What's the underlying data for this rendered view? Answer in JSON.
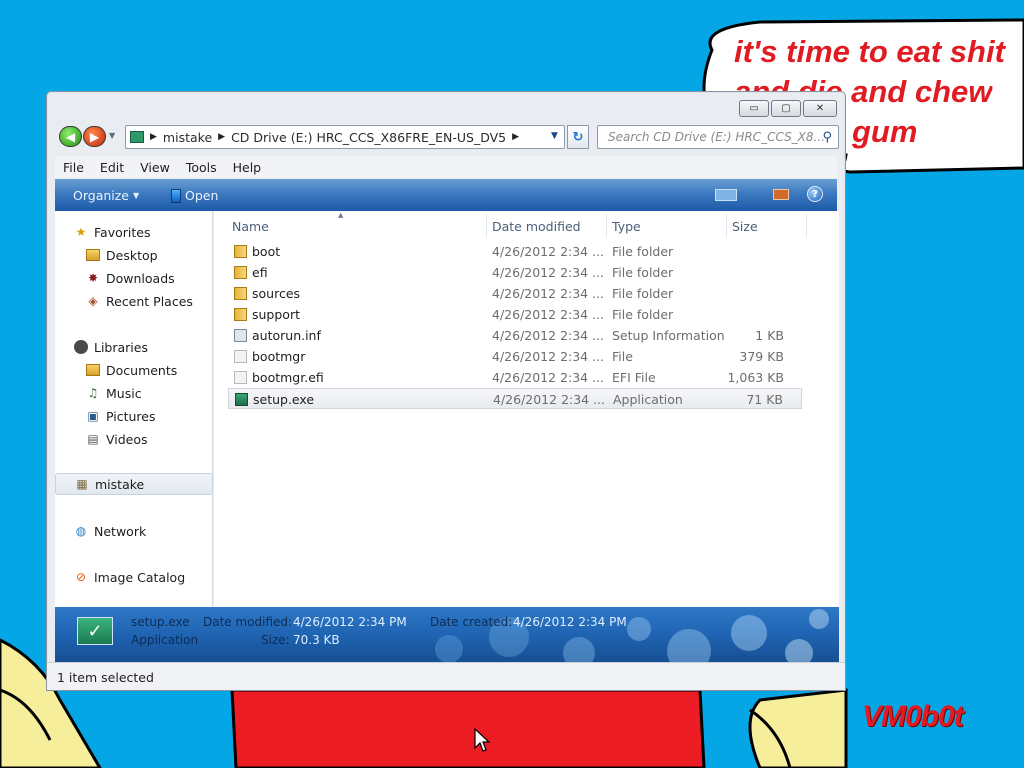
{
  "desktop": {
    "speech_bubble_lines": [
      "it's time to eat shit",
      "and die and chew",
      "gum"
    ],
    "watermark": "VM0b0t",
    "background_color": "#04a6e6"
  },
  "window": {
    "caption_buttons": {
      "minimize": "▭",
      "maximize": "▢",
      "close": "✕"
    },
    "address": {
      "segments": [
        "mistake",
        "CD Drive (E:) HRC_CCS_X86FRE_EN-US_DV5"
      ]
    },
    "search": {
      "placeholder": "Search CD Drive (E:) HRC_CCS_X8..."
    },
    "menu": [
      "File",
      "Edit",
      "View",
      "Tools",
      "Help"
    ],
    "toolbar": {
      "organize": "Organize",
      "open": "Open",
      "help": "?"
    },
    "nav": {
      "favorites": "Favorites",
      "favorites_items": [
        "Desktop",
        "Downloads",
        "Recent Places"
      ],
      "libraries": "Libraries",
      "libraries_items": [
        "Documents",
        "Music",
        "Pictures",
        "Videos"
      ],
      "user": "mistake",
      "network": "Network",
      "image_catalog": "Image Catalog"
    },
    "columns": {
      "name": "Name",
      "date": "Date modified",
      "type": "Type",
      "size": "Size"
    },
    "files": [
      {
        "name": "boot",
        "date": "4/26/2012 2:34 ...",
        "type": "File folder",
        "size": "",
        "icon": "folder-icon"
      },
      {
        "name": "efi",
        "date": "4/26/2012 2:34 ...",
        "type": "File folder",
        "size": "",
        "icon": "folder-icon"
      },
      {
        "name": "sources",
        "date": "4/26/2012 2:34 ...",
        "type": "File folder",
        "size": "",
        "icon": "folder-icon"
      },
      {
        "name": "support",
        "date": "4/26/2012 2:34 ...",
        "type": "File folder",
        "size": "",
        "icon": "folder-icon"
      },
      {
        "name": "autorun.inf",
        "date": "4/26/2012 2:34 ...",
        "type": "Setup Information",
        "size": "1 KB",
        "icon": "settings-file-icon"
      },
      {
        "name": "bootmgr",
        "date": "4/26/2012 2:34 ...",
        "type": "File",
        "size": "379 KB",
        "icon": "file-icon"
      },
      {
        "name": "bootmgr.efi",
        "date": "4/26/2012 2:34 ...",
        "type": "EFI File",
        "size": "1,063 KB",
        "icon": "file-icon"
      },
      {
        "name": "setup.exe",
        "date": "4/26/2012 2:34 ...",
        "type": "Application",
        "size": "71 KB",
        "icon": "setup-exe-icon",
        "selected": true
      }
    ],
    "details": {
      "name": "setup.exe",
      "kind": "Application",
      "date_modified_label": "Date modified:",
      "date_modified": "4/26/2012 2:34 PM",
      "date_created_label": "Date created:",
      "date_created": "4/26/2012 2:34 PM",
      "size_label": "Size:",
      "size": "70.3 KB"
    },
    "status": "1 item selected"
  }
}
